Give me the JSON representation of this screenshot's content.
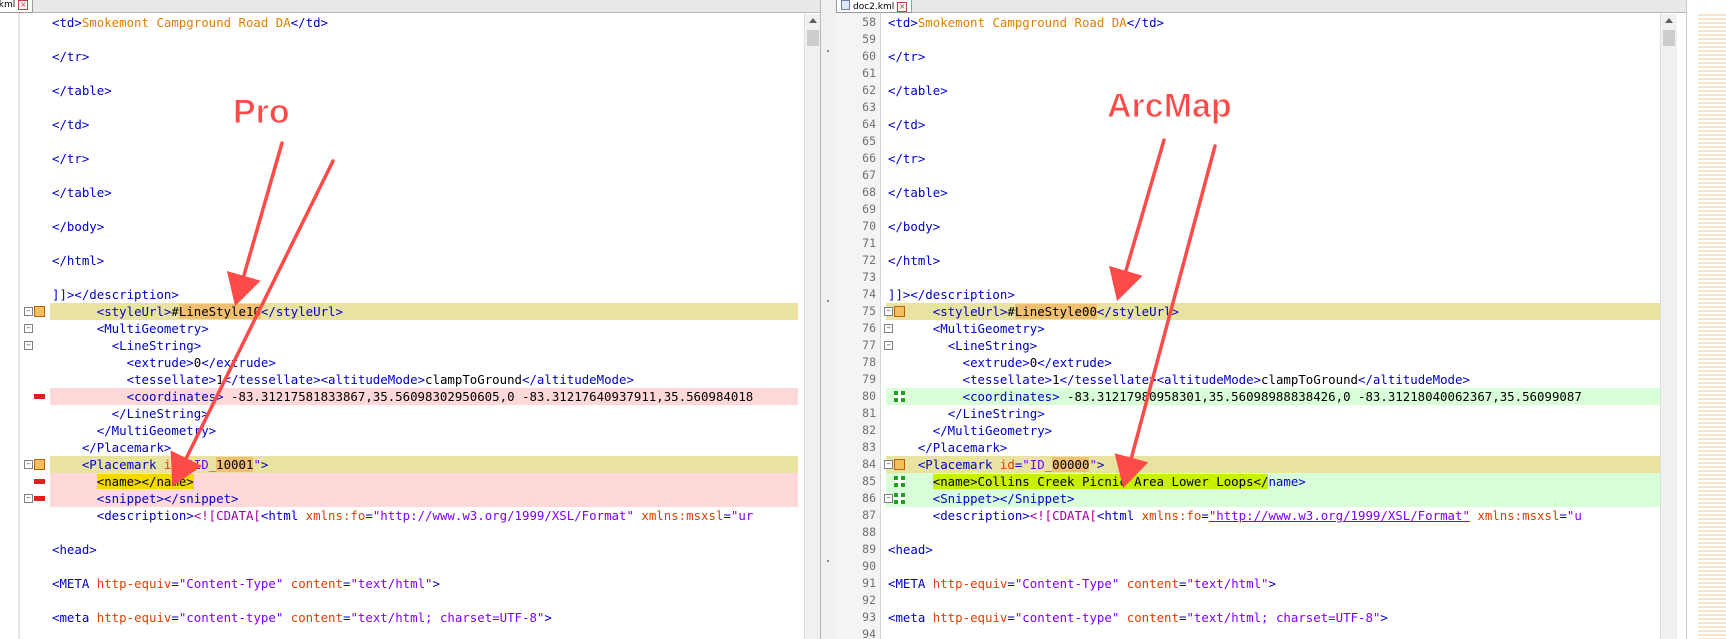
{
  "left_pane": {
    "tab_label": "c.kml",
    "annotation": "Pro",
    "lines": [
      {
        "n": "",
        "parts": [
          [
            "t",
            "<td>"
          ],
          [
            "tf",
            "Smokemont Campground Road DA"
          ],
          [
            "t",
            "</td>"
          ]
        ]
      },
      {
        "n": "",
        "parts": []
      },
      {
        "n": "",
        "parts": [
          [
            "t",
            "</tr>"
          ]
        ]
      },
      {
        "n": "",
        "parts": []
      },
      {
        "n": "",
        "parts": [
          [
            "t",
            "</table>"
          ]
        ]
      },
      {
        "n": "",
        "parts": []
      },
      {
        "n": "",
        "parts": [
          [
            "t",
            "</td>"
          ]
        ]
      },
      {
        "n": "",
        "parts": []
      },
      {
        "n": "",
        "parts": [
          [
            "t",
            "</tr>"
          ]
        ]
      },
      {
        "n": "",
        "parts": []
      },
      {
        "n": "",
        "parts": [
          [
            "t",
            "</table>"
          ]
        ]
      },
      {
        "n": "",
        "parts": []
      },
      {
        "n": "",
        "parts": [
          [
            "t",
            "</body>"
          ]
        ]
      },
      {
        "n": "",
        "parts": []
      },
      {
        "n": "",
        "parts": [
          [
            "t",
            "</html>"
          ]
        ]
      },
      {
        "n": "",
        "parts": []
      },
      {
        "n": "",
        "parts": [
          [
            "t",
            "]]></description>"
          ]
        ]
      },
      {
        "n": "",
        "parts": [
          [
            "tx",
            "      "
          ],
          [
            "t",
            "<styleUrl>"
          ],
          [
            "tx",
            "#"
          ],
          [
            "hl",
            "LineStyle10"
          ],
          [
            "t",
            "</styleUrl>"
          ]
        ]
      },
      {
        "n": "",
        "parts": [
          [
            "tx",
            "      "
          ],
          [
            "t",
            "<MultiGeometry>"
          ]
        ]
      },
      {
        "n": "",
        "parts": [
          [
            "tx",
            "        "
          ],
          [
            "t",
            "<LineString>"
          ]
        ]
      },
      {
        "n": "",
        "parts": [
          [
            "tx",
            "          "
          ],
          [
            "t",
            "<extrude>"
          ],
          [
            "tx",
            "0"
          ],
          [
            "t",
            "</extrude>"
          ]
        ]
      },
      {
        "n": "",
        "parts": [
          [
            "tx",
            "          "
          ],
          [
            "t",
            "<tessellate>"
          ],
          [
            "tx",
            "1"
          ],
          [
            "t",
            "</tessellate>"
          ],
          [
            "t",
            "<altitudeMode>"
          ],
          [
            "tx",
            "clampToGround"
          ],
          [
            "t",
            "</altitudeMode>"
          ]
        ]
      },
      {
        "n": "",
        "parts": [
          [
            "tx",
            "          "
          ],
          [
            "t",
            "<coordinates>"
          ],
          [
            "tx",
            " -83.31217581833867,35.56098302950605,0 -83.31217640937911,35.560984018"
          ]
        ]
      },
      {
        "n": "",
        "parts": [
          [
            "tx",
            "        "
          ],
          [
            "t",
            "</LineString>"
          ]
        ]
      },
      {
        "n": "",
        "parts": [
          [
            "tx",
            "      "
          ],
          [
            "t",
            "</MultiGeometry>"
          ]
        ]
      },
      {
        "n": "",
        "parts": [
          [
            "tx",
            "    "
          ],
          [
            "t",
            "</Placemark>"
          ]
        ]
      },
      {
        "n": "",
        "parts": [
          [
            "tx",
            "    "
          ],
          [
            "t",
            "<Placemark "
          ],
          [
            "at",
            "id"
          ],
          [
            "t",
            "="
          ],
          [
            "av",
            "\"ID_"
          ],
          [
            "hlo",
            "10001"
          ],
          [
            "av",
            "\""
          ],
          [
            "t",
            ">"
          ]
        ]
      },
      {
        "n": "",
        "parts": [
          [
            "tx",
            "      "
          ],
          [
            "hly",
            "<name></name>"
          ]
        ]
      },
      {
        "n": "",
        "parts": [
          [
            "tx",
            "      "
          ],
          [
            "t",
            "<snippet></snippet>"
          ]
        ]
      },
      {
        "n": "",
        "parts": [
          [
            "tx",
            "      "
          ],
          [
            "t",
            "<description>"
          ],
          [
            "ss",
            "<![CDATA["
          ],
          [
            "t",
            "<html "
          ],
          [
            "at",
            "xmlns:fo"
          ],
          [
            "t",
            "="
          ],
          [
            "av",
            "\"http://www.w3.org/1999/XSL/Format\""
          ],
          [
            "tx",
            " "
          ],
          [
            "at",
            "xmlns:msxsl"
          ],
          [
            "t",
            "="
          ],
          [
            "av",
            "\"ur"
          ]
        ]
      },
      {
        "n": "",
        "parts": []
      },
      {
        "n": "",
        "parts": [
          [
            "t",
            "<head>"
          ]
        ]
      },
      {
        "n": "",
        "parts": []
      },
      {
        "n": "",
        "parts": [
          [
            "t",
            "<META "
          ],
          [
            "at",
            "http-equiv"
          ],
          [
            "t",
            "="
          ],
          [
            "av",
            "\"Content-Type\""
          ],
          [
            "tx",
            " "
          ],
          [
            "at",
            "content"
          ],
          [
            "t",
            "="
          ],
          [
            "av",
            "\"text/html\""
          ],
          [
            "t",
            ">"
          ]
        ]
      },
      {
        "n": "",
        "parts": []
      },
      {
        "n": "",
        "parts": [
          [
            "t",
            "<meta "
          ],
          [
            "at",
            "http-equiv"
          ],
          [
            "t",
            "="
          ],
          [
            "av",
            "\"content-type\""
          ],
          [
            "tx",
            " "
          ],
          [
            "at",
            "content"
          ],
          [
            "t",
            "="
          ],
          [
            "av",
            "\"text/html; charset=UTF-8\""
          ],
          [
            "t",
            ">"
          ]
        ]
      }
    ]
  },
  "right_pane": {
    "tab_label": "doc2.kml",
    "annotation": "ArcMap",
    "lines": [
      {
        "n": "58",
        "parts": [
          [
            "t",
            "<td>"
          ],
          [
            "tf",
            "Smokemont Campground Road DA"
          ],
          [
            "t",
            "</td>"
          ]
        ]
      },
      {
        "n": "59",
        "parts": []
      },
      {
        "n": "60",
        "parts": [
          [
            "t",
            "</tr>"
          ]
        ]
      },
      {
        "n": "61",
        "parts": []
      },
      {
        "n": "62",
        "parts": [
          [
            "t",
            "</table>"
          ]
        ]
      },
      {
        "n": "63",
        "parts": []
      },
      {
        "n": "64",
        "parts": [
          [
            "t",
            "</td>"
          ]
        ]
      },
      {
        "n": "65",
        "parts": []
      },
      {
        "n": "66",
        "parts": [
          [
            "t",
            "</tr>"
          ]
        ]
      },
      {
        "n": "67",
        "parts": []
      },
      {
        "n": "68",
        "parts": [
          [
            "t",
            "</table>"
          ]
        ]
      },
      {
        "n": "69",
        "parts": []
      },
      {
        "n": "70",
        "parts": [
          [
            "t",
            "</body>"
          ]
        ]
      },
      {
        "n": "71",
        "parts": []
      },
      {
        "n": "72",
        "parts": [
          [
            "t",
            "</html>"
          ]
        ]
      },
      {
        "n": "73",
        "parts": []
      },
      {
        "n": "74",
        "parts": [
          [
            "t",
            "]]></description>"
          ]
        ]
      },
      {
        "n": "75",
        "parts": [
          [
            "tx",
            "      "
          ],
          [
            "t",
            "<styleUrl>"
          ],
          [
            "tx",
            "#"
          ],
          [
            "hl",
            "LineStyle00"
          ],
          [
            "t",
            "</styleUrl>"
          ]
        ]
      },
      {
        "n": "76",
        "parts": [
          [
            "tx",
            "      "
          ],
          [
            "t",
            "<MultiGeometry>"
          ]
        ]
      },
      {
        "n": "77",
        "parts": [
          [
            "tx",
            "        "
          ],
          [
            "t",
            "<LineString>"
          ]
        ]
      },
      {
        "n": "78",
        "parts": [
          [
            "tx",
            "          "
          ],
          [
            "t",
            "<extrude>"
          ],
          [
            "tx",
            "0"
          ],
          [
            "t",
            "</extrude>"
          ]
        ]
      },
      {
        "n": "79",
        "parts": [
          [
            "tx",
            "          "
          ],
          [
            "t",
            "<tessellate>"
          ],
          [
            "tx",
            "1"
          ],
          [
            "t",
            "</tessellate>"
          ],
          [
            "t",
            "<altitudeMode>"
          ],
          [
            "tx",
            "clampToGround"
          ],
          [
            "t",
            "</altitudeMode>"
          ]
        ]
      },
      {
        "n": "80",
        "parts": [
          [
            "tx",
            "          "
          ],
          [
            "t",
            "<coordinates>"
          ],
          [
            "tx",
            " -83.31217980958301,35.56098988838426,0 -83.31218040062367,35.56099087"
          ]
        ]
      },
      {
        "n": "81",
        "parts": [
          [
            "tx",
            "        "
          ],
          [
            "t",
            "</LineString>"
          ]
        ]
      },
      {
        "n": "82",
        "parts": [
          [
            "tx",
            "      "
          ],
          [
            "t",
            "</MultiGeometry>"
          ]
        ]
      },
      {
        "n": "83",
        "parts": [
          [
            "tx",
            "    "
          ],
          [
            "t",
            "</Placemark>"
          ]
        ]
      },
      {
        "n": "84",
        "parts": [
          [
            "tx",
            "    "
          ],
          [
            "t",
            "<Placemark "
          ],
          [
            "at",
            "id"
          ],
          [
            "t",
            "="
          ],
          [
            "av",
            "\"ID_"
          ],
          [
            "hlo",
            "00000"
          ],
          [
            "av",
            "\""
          ],
          [
            "t",
            ">"
          ]
        ]
      },
      {
        "n": "85",
        "parts": [
          [
            "tx",
            "      "
          ],
          [
            "hlg",
            "<name>Collins Creek Picnic Area Lower Loops</"
          ],
          [
            "t",
            "name>"
          ]
        ]
      },
      {
        "n": "86",
        "parts": [
          [
            "tx",
            "      "
          ],
          [
            "t",
            "<Snippet></Snippet>"
          ]
        ]
      },
      {
        "n": "87",
        "parts": [
          [
            "tx",
            "      "
          ],
          [
            "t",
            "<description>"
          ],
          [
            "ss",
            "<![CDATA["
          ],
          [
            "t",
            "<html "
          ],
          [
            "at",
            "xmlns:fo"
          ],
          [
            "t",
            "="
          ],
          [
            "lnk",
            "\"http://www.w3.org/1999/XSL/Format\""
          ],
          [
            "tx",
            " "
          ],
          [
            "at",
            "xmlns:msxsl"
          ],
          [
            "t",
            "="
          ],
          [
            "av",
            "\"u"
          ]
        ]
      },
      {
        "n": "88",
        "parts": []
      },
      {
        "n": "89",
        "parts": [
          [
            "t",
            "<head>"
          ]
        ]
      },
      {
        "n": "90",
        "parts": []
      },
      {
        "n": "91",
        "parts": [
          [
            "t",
            "<META "
          ],
          [
            "at",
            "http-equiv"
          ],
          [
            "t",
            "="
          ],
          [
            "av",
            "\"Content-Type\""
          ],
          [
            "tx",
            " "
          ],
          [
            "at",
            "content"
          ],
          [
            "t",
            "="
          ],
          [
            "av",
            "\"text/html\""
          ],
          [
            "t",
            ">"
          ]
        ]
      },
      {
        "n": "92",
        "parts": []
      },
      {
        "n": "93",
        "parts": [
          [
            "t",
            "<meta "
          ],
          [
            "at",
            "http-equiv"
          ],
          [
            "t",
            "="
          ],
          [
            "av",
            "\"content-type\""
          ],
          [
            "tx",
            " "
          ],
          [
            "at",
            "content"
          ],
          [
            "t",
            "="
          ],
          [
            "av",
            "\"text/html; charset=UTF-8\""
          ],
          [
            "t",
            ">"
          ]
        ]
      },
      {
        "n": "94",
        "parts": []
      }
    ]
  },
  "diff_rows": {
    "changed": [
      17,
      26
    ],
    "removed_left": [
      22,
      27,
      28
    ],
    "added_right": [
      22,
      27,
      28
    ]
  },
  "colors": {
    "changed_bg": "#e8e3a1",
    "removed_bg": "#ffd9d9",
    "added_bg": "#d9ffd9",
    "annotation_red": "#ff4a4a"
  },
  "icons": [
    "close-icon",
    "document-icon",
    "diff-removed-icon",
    "diff-added-icon",
    "diff-changed-icon",
    "fold-icon"
  ]
}
